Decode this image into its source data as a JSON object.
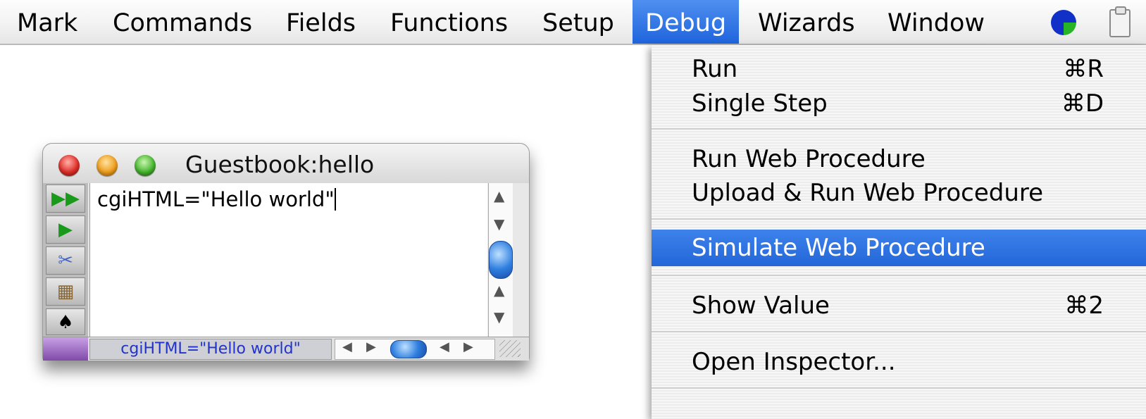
{
  "menubar": {
    "items": [
      "Mark",
      "Commands",
      "Fields",
      "Functions",
      "Setup",
      "Debug",
      "Wizards",
      "Window"
    ],
    "active": "Debug"
  },
  "status_icons": [
    "pie-clock-icon",
    "clipboard-icon"
  ],
  "debug_menu": {
    "items": [
      {
        "label": "Run",
        "shortcut": "⌘R"
      },
      {
        "label": "Single Step",
        "shortcut": "⌘D"
      },
      {
        "label": "Run Web Procedure",
        "shortcut": ""
      },
      {
        "label": "Upload & Run Web Procedure",
        "shortcut": ""
      },
      {
        "label": "Simulate Web Procedure",
        "shortcut": "",
        "highlighted": true
      },
      {
        "label": "Show Value",
        "shortcut": "⌘2"
      },
      {
        "label": "Open Inspector...",
        "shortcut": ""
      }
    ]
  },
  "window": {
    "title": "Guestbook:hello",
    "code": "cgiHTML=\"Hello world\"",
    "status_text": "cgiHTML=\"Hello world\"",
    "toolbar_icons": [
      "fast-forward-icon",
      "play-icon",
      "scissors-icon",
      "puzzle-icon",
      "spade-icon"
    ]
  },
  "colors": {
    "menu_highlight": "#2f73e0",
    "status_text": "#2233cc"
  }
}
